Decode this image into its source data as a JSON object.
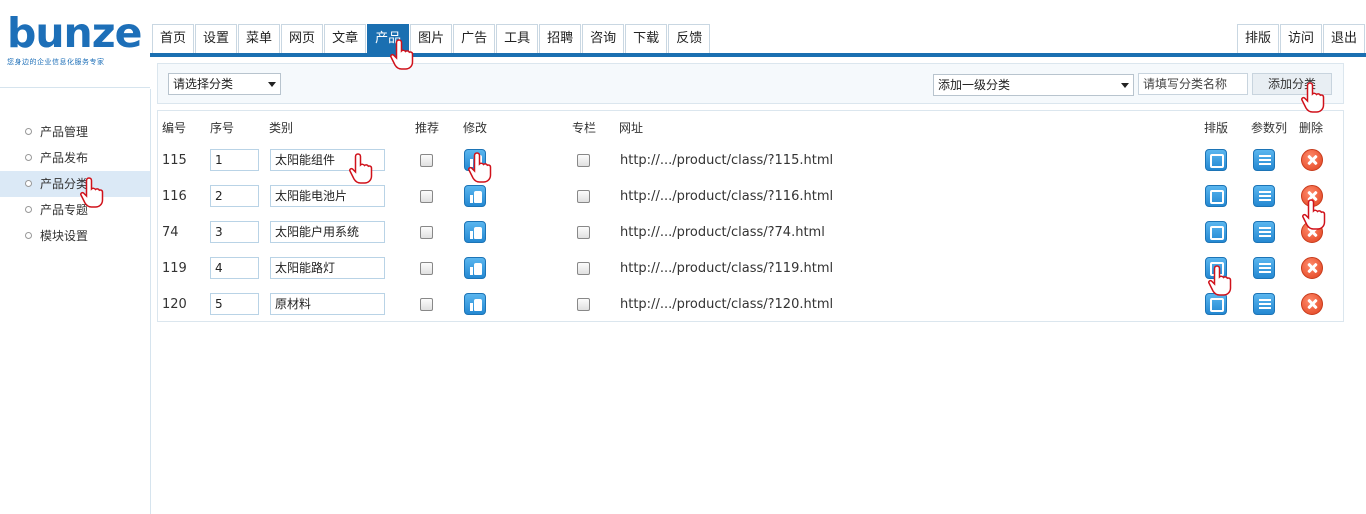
{
  "logo": {
    "text": "bunze",
    "tagline": "您身边的企业信息化服务专家"
  },
  "nav": {
    "tabs": [
      "首页",
      "设置",
      "菜单",
      "网页",
      "文章",
      "产品",
      "图片",
      "广告",
      "工具",
      "招聘",
      "咨询",
      "下载",
      "反馈"
    ],
    "active": "产品",
    "right": [
      "排版",
      "访问",
      "退出"
    ]
  },
  "sidebar": {
    "items": [
      "产品管理",
      "产品发布",
      "产品分类",
      "产品专题",
      "模块设置"
    ],
    "active": "产品分类"
  },
  "toolbar": {
    "category_select": "请选择分类",
    "level_select": "添加一级分类",
    "name_placeholder": "请填写分类名称",
    "add_label": "添加分类"
  },
  "table": {
    "headers": {
      "id": "编号",
      "order": "序号",
      "category": "类别",
      "recommend": "推荐",
      "edit": "修改",
      "column": "专栏",
      "url": "网址",
      "layout": "排版",
      "params": "参数列",
      "delete": "删除"
    },
    "rows": [
      {
        "id": "115",
        "order": "1",
        "category": "太阳能组件",
        "url": "http://.../product/class/?115.html"
      },
      {
        "id": "116",
        "order": "2",
        "category": "太阳能电池片",
        "url": "http://.../product/class/?116.html"
      },
      {
        "id": "74",
        "order": "3",
        "category": "太阳能户用系统",
        "url": "http://.../product/class/?74.html"
      },
      {
        "id": "119",
        "order": "4",
        "category": "太阳能路灯",
        "url": "http://.../product/class/?119.html"
      },
      {
        "id": "120",
        "order": "5",
        "category": "原材料",
        "url": "http://.../product/class/?120.html"
      }
    ]
  },
  "colors": {
    "brand": "#1a6fb1",
    "icon_blue": "#2488d2",
    "icon_red": "#e0401e"
  }
}
